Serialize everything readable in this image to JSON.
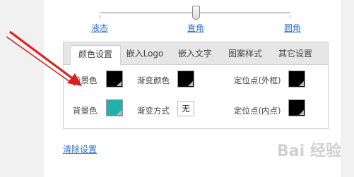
{
  "slider": {
    "labels": [
      "液态",
      "直角",
      "圆角"
    ]
  },
  "tabs": [
    {
      "label": "颜色设置",
      "active": true
    },
    {
      "label": "嵌入Logo",
      "active": false
    },
    {
      "label": "嵌入文字",
      "active": false
    },
    {
      "label": "图案样式",
      "active": false
    },
    {
      "label": "其它设置",
      "active": false
    }
  ],
  "color_settings": {
    "foreground_label": "前景色",
    "foreground_color": "#000000",
    "background_label": "背景色",
    "background_color": "#20b2aa",
    "gradient_color_label": "渐变颜色",
    "gradient_color": "#000000",
    "gradient_mode_label": "渐变方式",
    "gradient_mode_value": "无",
    "locator_outer_label": "定位点(外框)",
    "locator_outer_color": "#000000",
    "locator_inner_label": "定位点(内点)",
    "locator_inner_color": "#000000"
  },
  "clear_label": "清除设置",
  "watermark": "Bai 经验",
  "annotation_arrow_color": "#d92020"
}
